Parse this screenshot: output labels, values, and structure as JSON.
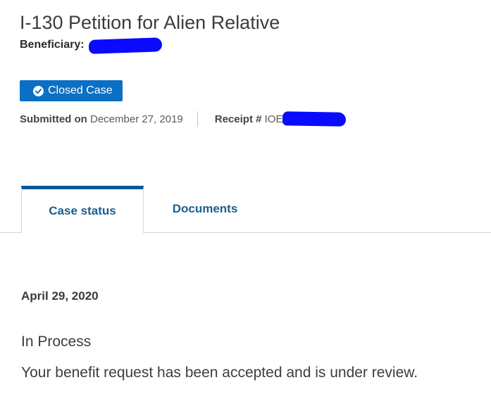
{
  "case": {
    "title": "I-130 Petition for Alien Relative",
    "beneficiary_label": "Beneficiary:",
    "status_badge": "Closed Case",
    "submitted_label": "Submitted on",
    "submitted_date": "December 27, 2019",
    "receipt_label": "Receipt #",
    "receipt_prefix": "IOE"
  },
  "tabs": [
    {
      "label": "Case status",
      "active": true
    },
    {
      "label": "Documents",
      "active": false
    }
  ],
  "status": {
    "date": "April 29, 2020",
    "title": "In Process",
    "description": "Your benefit request has been accepted and is under review."
  },
  "colors": {
    "badge": "#0b6fc4",
    "tab_accent": "#0b5794",
    "tab_text": "#1a5f8f",
    "redaction": "#0a0aff"
  },
  "icons": {
    "badge_icon": "check-circle-icon"
  }
}
